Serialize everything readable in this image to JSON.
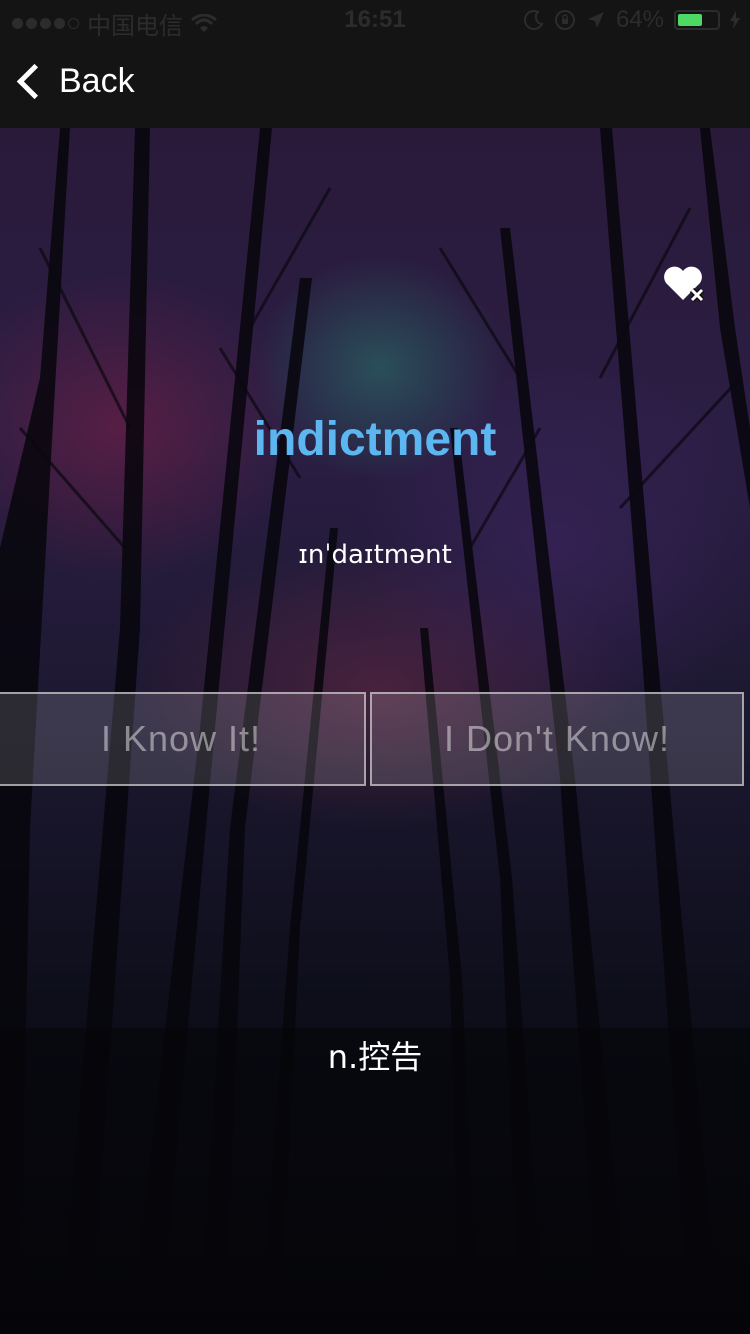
{
  "status_bar": {
    "carrier": "中国电信",
    "time": "16:51",
    "battery": "64%",
    "battery_level": 0.64
  },
  "nav": {
    "back_label": "Back"
  },
  "card": {
    "word": "indictment",
    "phonetic": "ɪnˈdaɪtmənt",
    "definition": "n.控告"
  },
  "actions": {
    "know_label": "I Know It!",
    "dont_know_label": "I Don't Know!"
  },
  "colors": {
    "word": "#5cb6f0",
    "battery_fill": "#4cd964",
    "bar_bg": "#141414"
  },
  "icons": {
    "favorite": "heart-remove-icon",
    "back": "chevron-left-icon"
  }
}
